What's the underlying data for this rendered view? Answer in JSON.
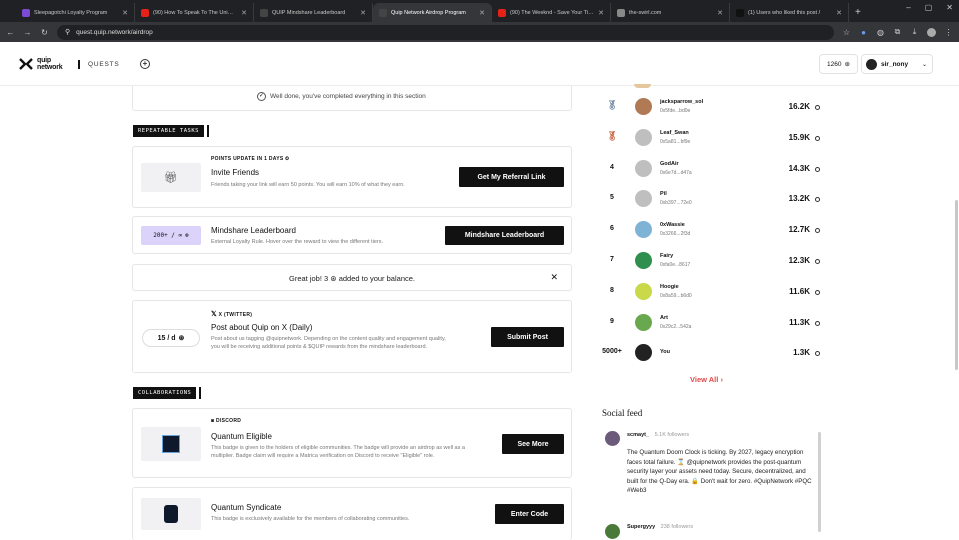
{
  "browser": {
    "tabs": [
      {
        "title": "Sleepagotchi Loyalty Program",
        "favicon_color": "#7b4bd6",
        "active": false
      },
      {
        "title": "(90) How To Speak To The Uni…",
        "favicon_color": "#e62117",
        "active": false
      },
      {
        "title": "QUIP Mindshare Leaderboard",
        "favicon_color": "#444444",
        "active": false
      },
      {
        "title": "Quip Network Airdrop Program",
        "favicon_color": "#444444",
        "active": true
      },
      {
        "title": "(90) The Weeknd - Save Your Ti…",
        "favicon_color": "#e62117",
        "active": false
      },
      {
        "title": "the-swirl.com",
        "favicon_color": "#888888",
        "active": false
      },
      {
        "title": "(1) Users who liked this post /",
        "favicon_color": "#111111",
        "active": false
      }
    ],
    "url": "quest.quip.network/airdrop"
  },
  "header": {
    "logo_top": "quip",
    "logo_bottom": "network",
    "nav_quests": "QUESTS",
    "points": "1260",
    "username": "sir_nony"
  },
  "main": {
    "completed_banner": "Well done, you've completed everything in this section",
    "repeatable_tag": "REPEATABLE TASKS",
    "referral": {
      "eyebrow": "POINTS UPDATE IN 1 DAYS",
      "title": "Invite Friends",
      "desc": "Friends taking your link will earn 50 points. You will earn 10% of what they earn.",
      "button": "Get My Referral Link"
    },
    "mindshare": {
      "badge": "200+ / ∞",
      "title": "Mindshare Leaderboard",
      "desc": "External Loyalty Rule. Hover over the reward to view the different tiers.",
      "button": "Mindshare Leaderboard"
    },
    "toast": {
      "text_before": "Great job! 3",
      "text_after": "added to your balance."
    },
    "twitter": {
      "eyebrow": "X (TWITTER)",
      "badge": "15 / d",
      "title": "Post about Quip on X (Daily)",
      "desc": "Post about us tagging @quipnetwork. Depending on the content quality and engagement quality, you will be receiving additional points & $QUIP rewards from the mindshare leaderboard.",
      "button": "Submit Post"
    },
    "collab_tag": "COLLABORATIONS",
    "discord": {
      "eyebrow": "DISCORD",
      "title": "Quantum Eligible",
      "desc": "This badge is given to the holders of eligible communities. The badge will provide an airdrop as well as a multiplier. Badge claim will require a Matrica verification on Discord to receive \"Eligible\" role.",
      "button": "See More"
    },
    "syndicate": {
      "title": "Quantum Syndicate",
      "desc": "This badge is exclusively available for the members of collaborating communities.",
      "button": "Enter Code"
    }
  },
  "leaderboard": {
    "rows": [
      {
        "rank": "",
        "name": "jacksparrow_sol",
        "addr": "0x5fde...bd0e",
        "score": "16.2K",
        "avatar_color": "#b07a55",
        "medal": "silver"
      },
      {
        "rank": "",
        "name": "Leaf_Swan",
        "addr": "0x5a81...bf9e",
        "score": "15.9K",
        "avatar_color": "#bfbfbf",
        "medal": "bronze"
      },
      {
        "rank": "4",
        "name": "GodAir",
        "addr": "0x6e7d...d47a",
        "score": "14.3K",
        "avatar_color": "#bfbfbf",
        "medal": ""
      },
      {
        "rank": "5",
        "name": "Pil",
        "addr": "0xb397...72e0",
        "score": "13.2K",
        "avatar_color": "#bfbfbf",
        "medal": ""
      },
      {
        "rank": "6",
        "name": "0xWassie",
        "addr": "0x3266...2f3d",
        "score": "12.7K",
        "avatar_color": "#7fb3d6",
        "medal": ""
      },
      {
        "rank": "7",
        "name": "Fairy",
        "addr": "0xfa0e...8617",
        "score": "12.3K",
        "avatar_color": "#2f8f4e",
        "medal": ""
      },
      {
        "rank": "8",
        "name": "Hoogie",
        "addr": "0x8a59...b6d0",
        "score": "11.6K",
        "avatar_color": "#c9d94a",
        "medal": ""
      },
      {
        "rank": "9",
        "name": "Art",
        "addr": "0x29c2...542a",
        "score": "11.3K",
        "avatar_color": "#6aa84f",
        "medal": ""
      },
      {
        "rank": "5000+",
        "name": "You",
        "addr": "",
        "score": "1.3K",
        "avatar_color": "#222222",
        "medal": ""
      }
    ],
    "view_all": "View All"
  },
  "social_feed": {
    "title": "Social feed",
    "posts": [
      {
        "user": "scmayt_",
        "followers": "5.1K followers",
        "text": "The Quantum Doom Clock is ticking. By 2027, legacy encryption faces total failure. ⌛ @quipnetwork provides the post-quantum security layer your assets need today. Secure, decentralized, and built for the Q-Day era. 🔒 Don't wait for zero. #QuipNetwork #PQC #Web3"
      },
      {
        "user": "Supergyyy",
        "followers": "238 followers",
        "text": ""
      }
    ]
  },
  "colors": {
    "accent_red": "#e54848",
    "dark": "#111111",
    "chrome_bg": "#202124"
  }
}
